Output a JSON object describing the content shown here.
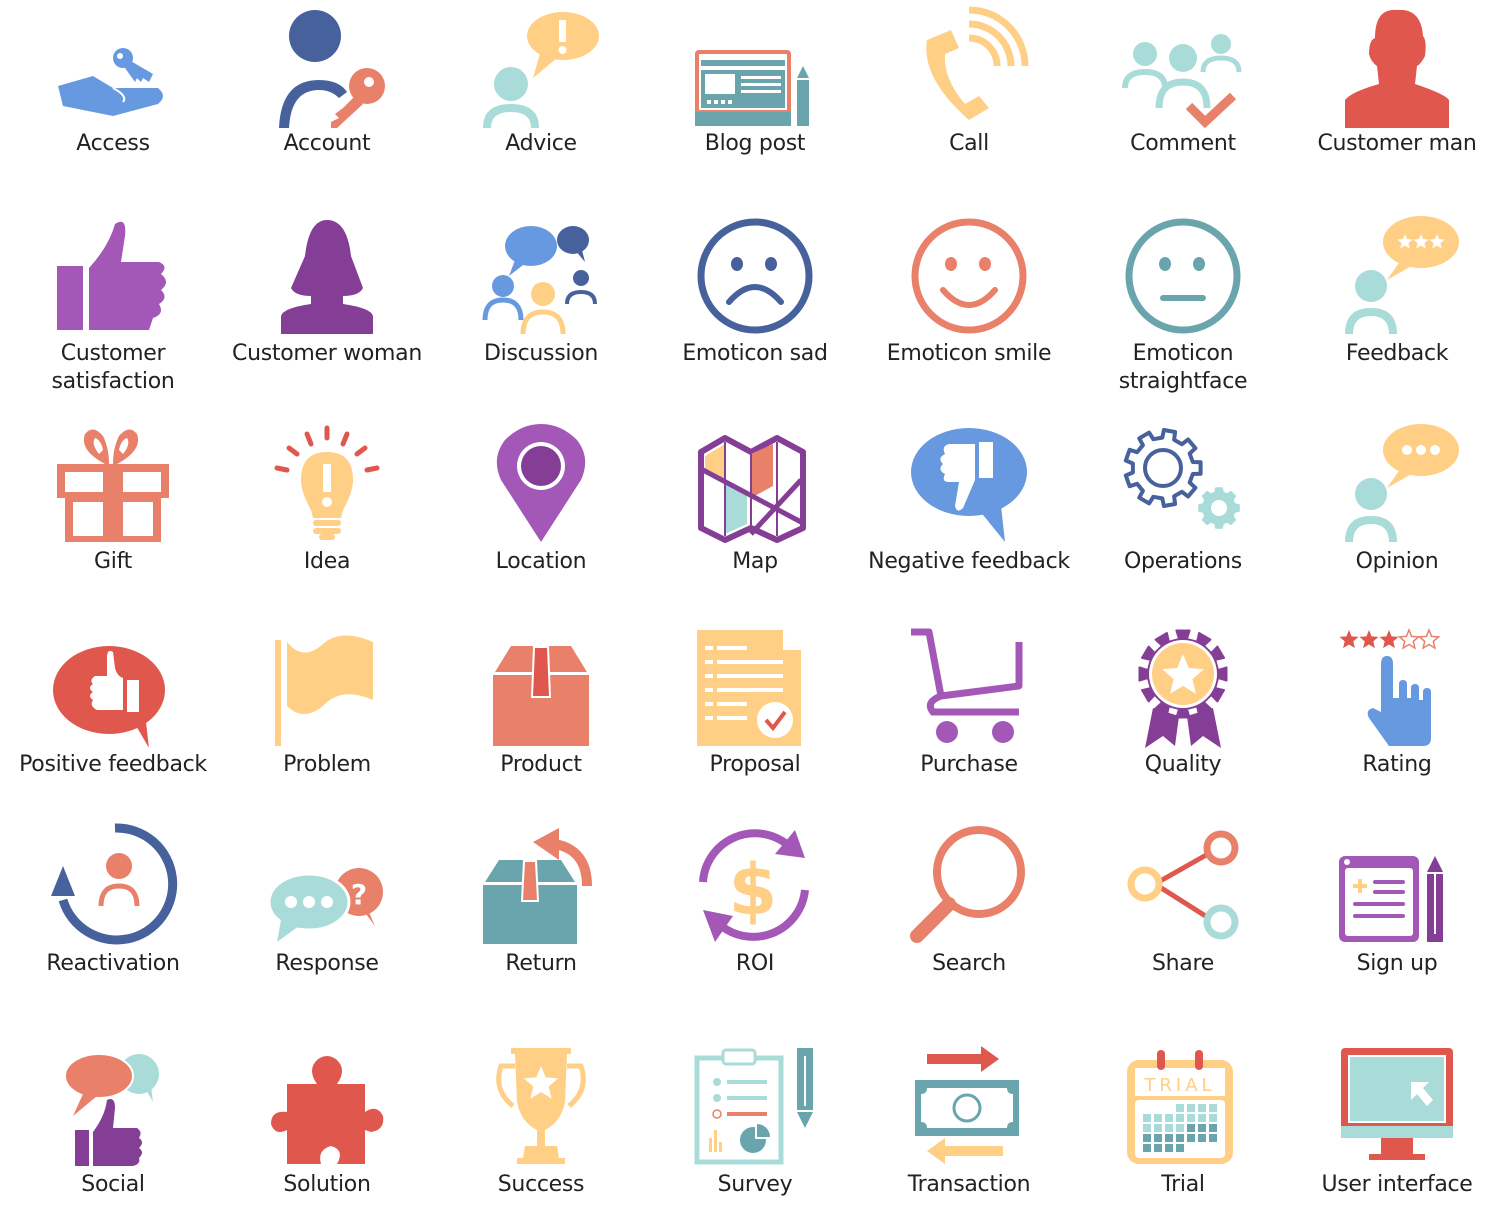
{
  "colors": {
    "blue": "#6699e0",
    "dark_blue": "#46619b",
    "coral": "#e8806a",
    "red": "#e0574d",
    "yellow": "#ffcf86",
    "teal": "#a9dcd9",
    "dark_teal": "#6aa5ae",
    "purple": "#a358b8",
    "dark_purple": "#853e96",
    "label_text": "#222222"
  },
  "icons": [
    {
      "label": "Access",
      "icon": "hand-key-icon"
    },
    {
      "label": "Account",
      "icon": "user-key-icon"
    },
    {
      "label": "Advice",
      "icon": "person-exclamation-bubble-icon"
    },
    {
      "label": "Blog post",
      "icon": "blog-screen-pencil-icon"
    },
    {
      "label": "Call",
      "icon": "phone-ringing-icon"
    },
    {
      "label": "Comment",
      "icon": "group-checkmark-icon"
    },
    {
      "label": "Customer man",
      "icon": "man-silhouette-icon"
    },
    {
      "label": "Customer satisfaction",
      "icon": "thumbs-up-icon"
    },
    {
      "label": "Customer woman",
      "icon": "woman-silhouette-icon"
    },
    {
      "label": "Discussion",
      "icon": "people-speech-bubbles-icon"
    },
    {
      "label": "Emoticon sad",
      "icon": "sad-face-icon"
    },
    {
      "label": "Emoticon smile",
      "icon": "smile-face-icon"
    },
    {
      "label": "Emoticon straightface",
      "icon": "neutral-face-icon"
    },
    {
      "label": "Feedback",
      "icon": "person-stars-bubble-icon"
    },
    {
      "label": "Gift",
      "icon": "gift-box-icon"
    },
    {
      "label": "Idea",
      "icon": "light-bulb-icon"
    },
    {
      "label": "Location",
      "icon": "map-pin-icon"
    },
    {
      "label": "Map",
      "icon": "folded-map-icon"
    },
    {
      "label": "Negative feedback",
      "icon": "thumbs-down-bubble-icon"
    },
    {
      "label": "Operations",
      "icon": "gears-icon"
    },
    {
      "label": "Opinion",
      "icon": "person-dots-bubble-icon"
    },
    {
      "label": "Positive feedback",
      "icon": "thumbs-up-bubble-icon"
    },
    {
      "label": "Problem",
      "icon": "flag-icon"
    },
    {
      "label": "Product",
      "icon": "box-icon"
    },
    {
      "label": "Proposal",
      "icon": "document-check-icon"
    },
    {
      "label": "Purchase",
      "icon": "shopping-cart-icon"
    },
    {
      "label": "Quality",
      "icon": "award-ribbon-star-icon"
    },
    {
      "label": "Rating",
      "icon": "hand-stars-rating-icon"
    },
    {
      "label": "Reactivation",
      "icon": "user-refresh-icon"
    },
    {
      "label": "Response",
      "icon": "chat-question-bubbles-icon"
    },
    {
      "label": "Return",
      "icon": "box-return-arrow-icon"
    },
    {
      "label": "ROI",
      "icon": "dollar-cycle-icon"
    },
    {
      "label": "Search",
      "icon": "magnifier-icon"
    },
    {
      "label": "Share",
      "icon": "share-nodes-icon"
    },
    {
      "label": "Sign up",
      "icon": "form-pencil-icon"
    },
    {
      "label": "Social",
      "icon": "bubbles-thumbs-up-icon"
    },
    {
      "label": "Solution",
      "icon": "puzzle-piece-icon"
    },
    {
      "label": "Success",
      "icon": "trophy-star-icon"
    },
    {
      "label": "Survey",
      "icon": "clipboard-chart-pencil-icon"
    },
    {
      "label": "Transaction",
      "icon": "money-arrows-icon"
    },
    {
      "label": "Trial",
      "icon": "calendar-trial-icon"
    },
    {
      "label": "User interface",
      "icon": "monitor-cursor-icon"
    }
  ],
  "rating_icon": {
    "stars_filled": 3,
    "stars_total": 5
  },
  "trial_icon_text": "TRIAL"
}
